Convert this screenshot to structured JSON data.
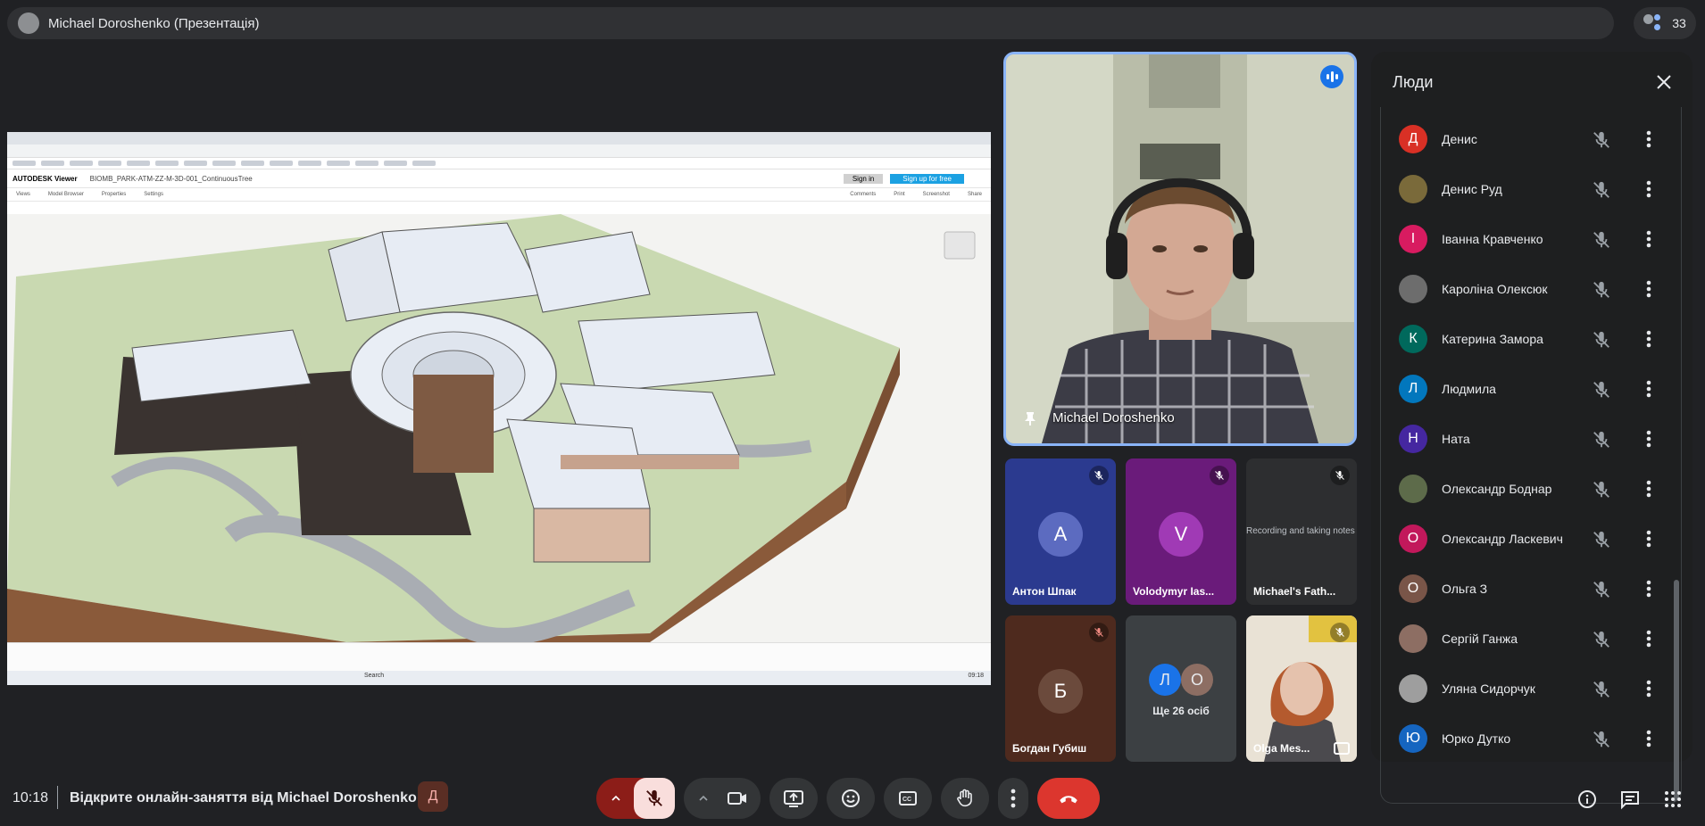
{
  "presenter_bar": {
    "title": "Michael Doroshenko (Презентація)",
    "participant_count": "33"
  },
  "shared_screen": {
    "viewer_brand": "AUTODESK Viewer",
    "model_file": "BIOMB_PARK-ATM-ZZ-M-3D-001_ContinuousTree",
    "toolbar": [
      "Views",
      "Model Browser",
      "Properties",
      "Settings"
    ],
    "toolbar_right": [
      "Comments",
      "Print",
      "Screenshot",
      "Share"
    ],
    "sign_buttons": [
      "Sign in",
      "Sign up for free"
    ],
    "taskbar_search": "Search",
    "clock": "09:18"
  },
  "pinned_speaker": {
    "name": "Michael Doroshenko"
  },
  "tiles": [
    {
      "name": "Антон Шпак",
      "initial": "A",
      "bg": "#2b3a8f",
      "avatar": "#5c6bc0"
    },
    {
      "name": "Volodymyr Ias...",
      "initial": "V",
      "bg": "#6a1b7a",
      "avatar": "#a03ab5"
    },
    {
      "name": "Michael's Fath...",
      "caption": "Recording and taking notes"
    },
    {
      "name": "Богдан Губиш",
      "initial": "Б",
      "bg": "#4e2a1e",
      "avatar": "#6b4a3c"
    },
    {
      "more_label": "Ще 26 осіб",
      "initials": [
        "Л",
        "О"
      ]
    },
    {
      "name": "Olga Mes..."
    }
  ],
  "people_panel": {
    "title": "Люди",
    "people": [
      {
        "name": "Денис",
        "initial": "Д",
        "color": "#d93025"
      },
      {
        "name": "Денис Руд",
        "initial": "",
        "color": "#7a6a3a"
      },
      {
        "name": "Іванна Кравченко",
        "initial": "І",
        "color": "#d81b60"
      },
      {
        "name": "Кароліна Олексюк",
        "initial": "",
        "color": "#6d6d6d"
      },
      {
        "name": "Катерина Замора",
        "initial": "К",
        "color": "#00695c"
      },
      {
        "name": "Людмила",
        "initial": "Л",
        "color": "#0277bd"
      },
      {
        "name": "Ната",
        "initial": "Н",
        "color": "#4527a0"
      },
      {
        "name": "Олександр Боднар",
        "initial": "",
        "color": "#5d6b4a"
      },
      {
        "name": "Олександр Ласкевич",
        "initial": "О",
        "color": "#c2185b"
      },
      {
        "name": "Ольга З",
        "initial": "О",
        "color": "#795548"
      },
      {
        "name": "Сергій Ганжа",
        "initial": "",
        "color": "#8d6e63"
      },
      {
        "name": "Уляна Сидорчук",
        "initial": "",
        "color": "#9e9e9e"
      },
      {
        "name": "Юрко Дутко",
        "initial": "Ю",
        "color": "#1565c0"
      }
    ]
  },
  "bottom_bar": {
    "time": "10:18",
    "meeting_title": "Відкрите онлайн-заняття від Michael Doroshenko",
    "host_badge": "Д"
  }
}
